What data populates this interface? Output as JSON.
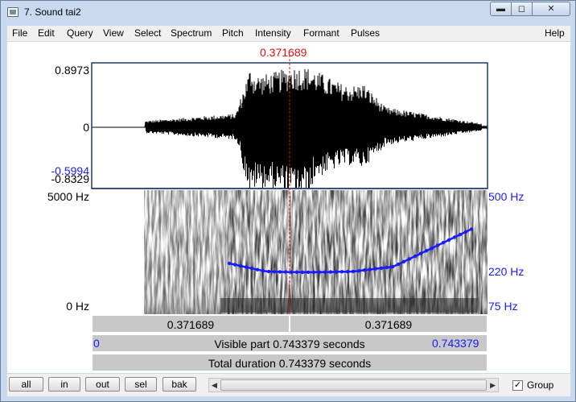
{
  "window": {
    "title": "7. Sound tai2"
  },
  "menu": [
    "File",
    "Edit",
    "Query",
    "View",
    "Select",
    "Spectrum",
    "Pitch",
    "Intensity",
    "Formant",
    "Pulses"
  ],
  "help_label": "Help",
  "cursor_time": "0.371689",
  "waveform": {
    "max_label": "0.8973",
    "zero_label": "0",
    "min_label": "-0.8329",
    "cursor_value": "-0.5994"
  },
  "spectrogram": {
    "freq_top": "5000 Hz",
    "freq_bottom": "0 Hz"
  },
  "pitch": {
    "top": "500 Hz",
    "mid": "220 Hz",
    "bottom": "75 Hz",
    "color": "#1a1aff"
  },
  "time_bar": {
    "left": "0.371689",
    "right": "0.371689"
  },
  "visible_bar": {
    "start": "0",
    "text": "Visible part 0.743379 seconds",
    "end": "0.743379"
  },
  "total_bar": {
    "text": "Total duration 0.743379 seconds"
  },
  "buttons": {
    "all": "all",
    "in": "in",
    "out": "out",
    "sel": "sel",
    "bak": "bak"
  },
  "group": {
    "label": "Group",
    "checked": true
  }
}
